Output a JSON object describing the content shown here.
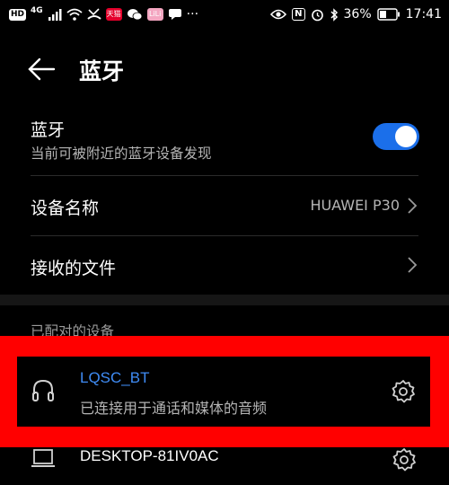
{
  "status_bar": {
    "hd": "HD",
    "network": "4G",
    "app_badge_1": "天猫",
    "app_badge_2": "LiLi",
    "more": "···",
    "nfc": "N",
    "battery": "36%",
    "time": "17:41"
  },
  "header": {
    "title": "蓝牙"
  },
  "bluetooth_row": {
    "title": "蓝牙",
    "subtitle": "当前可被附近的蓝牙设备发现",
    "enabled": true
  },
  "device_name_row": {
    "title": "设备名称",
    "value": "HUAWEI P30"
  },
  "received_files_row": {
    "title": "接收的文件"
  },
  "paired_section": {
    "header": "已配对的设备",
    "devices": [
      {
        "name": "LQSC_BT",
        "status": "已连接用于通话和媒体的音频",
        "icon": "headset-icon"
      },
      {
        "name": "DESKTOP-81IV0AC",
        "status": "",
        "icon": "laptop-icon"
      }
    ]
  },
  "colors": {
    "accent": "#1b6fea",
    "connected_text": "#3f8cf5",
    "highlight": "#ff0000",
    "background": "#000000"
  }
}
